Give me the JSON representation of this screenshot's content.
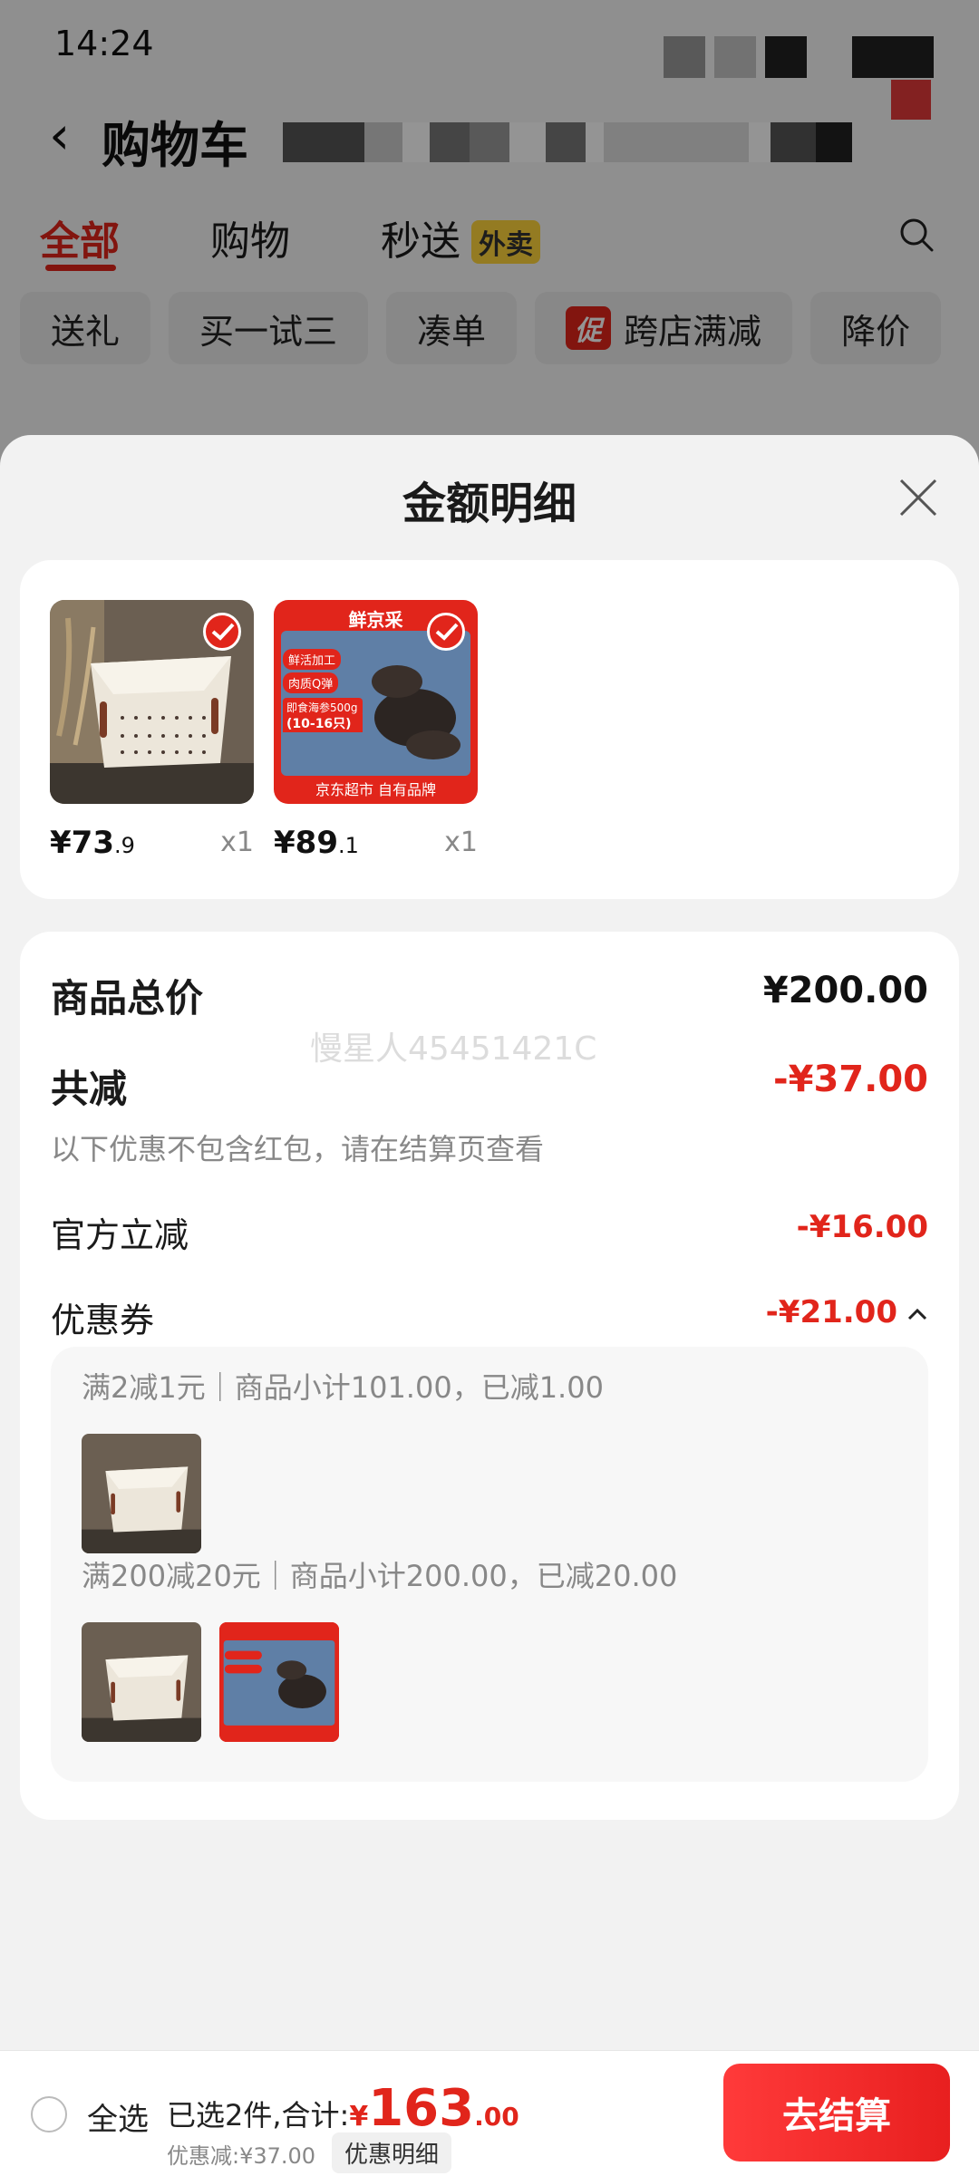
{
  "status_bar": {
    "time": "14:24"
  },
  "header": {
    "title": "购物车"
  },
  "tabs": [
    {
      "label": "全部",
      "active": true
    },
    {
      "label": "购物",
      "active": false
    },
    {
      "label": "秒送",
      "active": false,
      "badge": "外卖"
    }
  ],
  "filter_chips": [
    {
      "label": "送礼"
    },
    {
      "label": "买一试三"
    },
    {
      "label": "凑单"
    },
    {
      "label": "跨店满减",
      "tag": "促"
    },
    {
      "label": "降价"
    }
  ],
  "sheet": {
    "title": "金额明细",
    "products": [
      {
        "name": "basket",
        "price_int": "¥73",
        "price_dec": ".9",
        "qty": "x1",
        "checked": true
      },
      {
        "name": "sea-cucumber",
        "price_int": "¥89",
        "price_dec": ".1",
        "qty": "x1",
        "checked": true,
        "brand": "鲜京采",
        "tags": [
          "鲜活加工",
          "肉质Q弹"
        ],
        "pack": "即食海参500g",
        "count": "(10-16只)",
        "footer": "京东超市 自有品牌"
      }
    ],
    "detail": {
      "total_label": "商品总价",
      "total_value": "¥200.00",
      "reduce_label": "共减",
      "reduce_value": "-¥37.00",
      "reduce_note": "以下优惠不包含红包，请在结算页查看",
      "official_label": "官方立减",
      "official_value": "-¥16.00",
      "coupon_label": "优惠券",
      "coupon_value": "-¥21.00",
      "watermark": "慢星人45451421C",
      "coupons": [
        {
          "text": "满2减1元｜商品小计101.00，已减1.00",
          "items": [
            "basket"
          ]
        },
        {
          "text": "满200减20元｜商品小计200.00，已减20.00",
          "items": [
            "basket",
            "sea-cucumber"
          ]
        }
      ]
    }
  },
  "bottom_bar": {
    "select_all": "全选",
    "selected_text": "已选2件,合计:",
    "currency": "¥",
    "total_int": "163",
    "total_dec": ".00",
    "discount_text": "优惠减:¥37.00",
    "detail_button": "优惠明细",
    "checkout": "去结算"
  },
  "colors": {
    "accent": "#e1251b",
    "badge": "#ffd43b"
  }
}
